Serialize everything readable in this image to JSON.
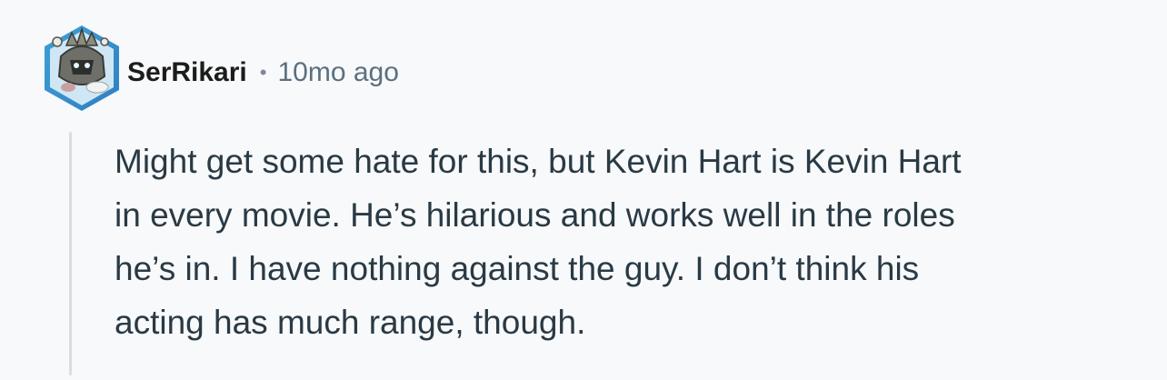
{
  "comment": {
    "author": "SerRikari",
    "separator": "•",
    "timestamp": "10mo ago",
    "avatar_icon": "robot-knight-avatar-icon",
    "body_lines": [
      "Might get some hate for this, but Kevin Hart is Kevin Hart",
      "in every movie. He’s hilarious and works well in the roles",
      "he’s in. I have nothing against the guy. I don’t think his",
      "acting has much range, though."
    ]
  },
  "colors": {
    "background": "#f7f9fb",
    "author": "#1c1c1c",
    "timestamp": "#5c6f7f",
    "body_text": "#2a3a44",
    "thread_line": "#d7dee4"
  }
}
